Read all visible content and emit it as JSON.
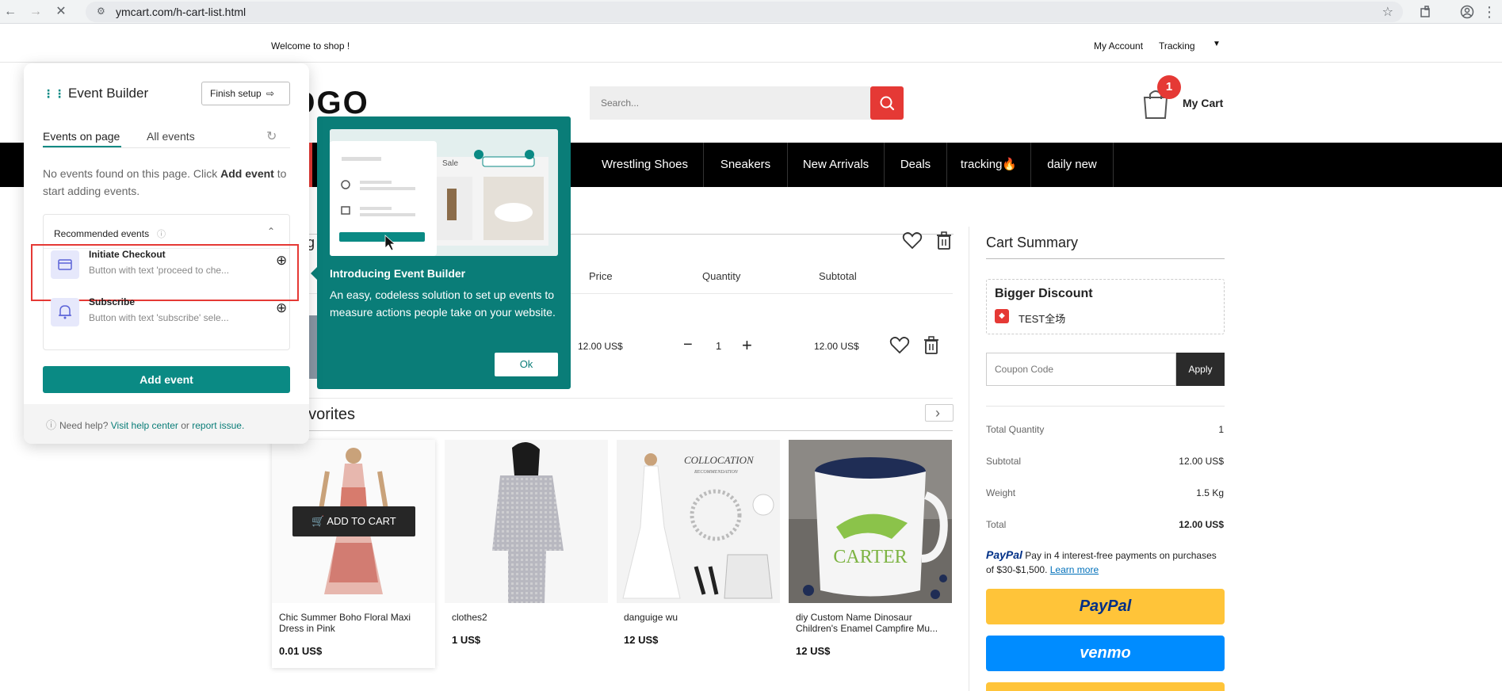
{
  "browser": {
    "url": "ymcart.com/h-cart-list.html"
  },
  "topbar": {
    "welcome": "Welcome to shop !",
    "my_account": "My Account",
    "tracking": "Tracking"
  },
  "header": {
    "logo": "LOGO",
    "search_placeholder": "Search...",
    "cart_badge": "1",
    "cart_label": "My Cart"
  },
  "nav": {
    "items": [
      "Wrestling Shoes",
      "Sneakers",
      "New Arrivals",
      "Deals",
      "tracking🔥",
      "daily new"
    ]
  },
  "cart": {
    "columns": [
      "Price",
      "Quantity",
      "Subtotal"
    ],
    "row": {
      "price": "12.00 US$",
      "quantity": "1",
      "subtotal": "12.00 US$"
    },
    "minus": "−",
    "plus": "+"
  },
  "favorites": {
    "title": "avorites",
    "add_to_cart": "ADD TO CART",
    "items": [
      {
        "name": "Chic Summer Boho Floral Maxi Dress in Pink",
        "price": "0.01 US$"
      },
      {
        "name": "clothes2",
        "price": "1 US$"
      },
      {
        "name": "danguige wu",
        "price": "12 US$"
      },
      {
        "name": "diy Custom Name Dinosaur Children's Enamel Campfire Mu...",
        "price": "12 US$"
      }
    ],
    "collocation_title": "COLLOCATION",
    "collocation_subtitle": "RECOMMENDATION",
    "mug_text": "CARTER"
  },
  "summary": {
    "title": "Cart Summary",
    "discount_title": "Bigger Discount",
    "discount_tag": "TEST全场",
    "coupon_placeholder": "Coupon Code",
    "apply": "Apply",
    "rows": [
      {
        "label": "Total Quantity",
        "value": "1"
      },
      {
        "label": "Subtotal",
        "value": "12.00 US$"
      },
      {
        "label": "Weight",
        "value": "1.5 Kg"
      },
      {
        "label": "Total",
        "value": "12.00 US$"
      }
    ],
    "paypal_brand": "PayPal",
    "paypal_text": "Pay in 4 interest-free payments on purchases of $30-$1,500.",
    "learn_more": "Learn more",
    "paypal_button": "PayPal",
    "venmo_button": "venmo",
    "colors": {
      "paypal_yellow": "#ffc439",
      "venmo_blue": "#008cff"
    }
  },
  "event_builder": {
    "title": "Event Builder",
    "finish_setup": "Finish setup",
    "tabs": [
      "Events on page",
      "All events"
    ],
    "no_events_prefix": "No events found on this page. Click ",
    "no_events_bold": "Add event",
    "no_events_suffix": " to start adding events.",
    "recommended_title": "Recommended events",
    "recommended": [
      {
        "title": "Initiate Checkout",
        "desc": "Button with text 'proceed to che..."
      },
      {
        "title": "Subscribe",
        "desc": "Button with text 'subscribe' sele..."
      }
    ],
    "add_event": "Add event",
    "help_prefix": "Need help? ",
    "help_link": "Visit help center",
    "help_or": " or ",
    "report_link": "report issue.",
    "accent": "#0a8a84"
  },
  "tooltip": {
    "preview_sale": "Sale",
    "title": "Introducing Event Builder",
    "body": "An easy, codeless solution to set up events to measure actions people take on your website.",
    "ok": "Ok"
  }
}
